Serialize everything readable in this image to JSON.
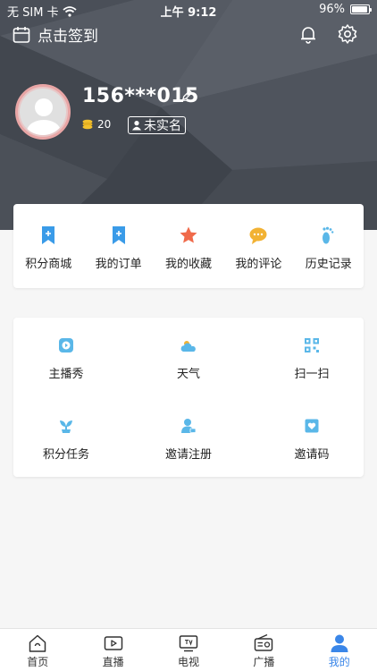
{
  "status_bar": {
    "carrier": "无 SIM 卡",
    "time": "上午 9:12",
    "battery": "96%",
    "battery_level": 0.96
  },
  "header": {
    "signin_label": "点击签到",
    "username": "156***015",
    "coins": "20",
    "verify_badge": "未实名",
    "bg_color": "#4a4f58"
  },
  "quick_actions": [
    {
      "label": "积分商城",
      "icon": "bookmark-plus-icon",
      "color": "#3a9be8"
    },
    {
      "label": "我的订单",
      "icon": "bookmark-plus-icon",
      "color": "#3a9be8"
    },
    {
      "label": "我的收藏",
      "icon": "star-icon",
      "color": "#f06a4a"
    },
    {
      "label": "我的评论",
      "icon": "chat-bubble-icon",
      "color": "#f2b233"
    },
    {
      "label": "历史记录",
      "icon": "footprint-icon",
      "color": "#5ab7e8"
    }
  ],
  "services": [
    {
      "label": "主播秀",
      "icon": "video-play-icon"
    },
    {
      "label": "天气",
      "icon": "weather-icon"
    },
    {
      "label": "扫一扫",
      "icon": "scan-icon"
    },
    {
      "label": "积分任务",
      "icon": "sprout-icon"
    },
    {
      "label": "邀请注册",
      "icon": "user-invite-icon"
    },
    {
      "label": "邀请码",
      "icon": "invite-code-icon"
    }
  ],
  "tabs": [
    {
      "label": "首页",
      "icon": "home-icon"
    },
    {
      "label": "直播",
      "icon": "live-icon"
    },
    {
      "label": "电视",
      "icon": "tv-icon"
    },
    {
      "label": "广播",
      "icon": "radio-icon"
    },
    {
      "label": "我的",
      "icon": "profile-icon",
      "active": true
    }
  ],
  "colors": {
    "accent": "#3a86e8",
    "icon_blue": "#5ab7e8"
  }
}
